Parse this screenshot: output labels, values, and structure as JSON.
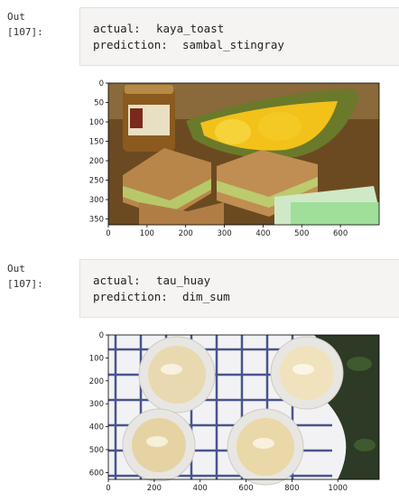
{
  "outputs": [
    {
      "prompt_out": "Out",
      "prompt_num": "[107]:",
      "actual_label": "actual:",
      "actual_value": "kaya_toast",
      "prediction_label": "prediction:",
      "prediction_value": "sambal_stingray",
      "image_plot": {
        "x_ticks": [
          "0",
          "100",
          "200",
          "300",
          "400",
          "500",
          "600"
        ],
        "y_ticks": [
          "0",
          "50",
          "100",
          "150",
          "200",
          "250",
          "300",
          "350"
        ],
        "x_range": [
          0,
          700
        ],
        "y_range": [
          0,
          365
        ],
        "photo": "kaya toast sandwiches with jar and durian"
      }
    },
    {
      "prompt_out": "Out",
      "prompt_num": "[107]:",
      "actual_label": "actual:",
      "actual_value": "tau_huay",
      "prediction_label": "prediction:",
      "prediction_value": "dim_sum",
      "image_plot": {
        "x_ticks": [
          "0",
          "200",
          "400",
          "600",
          "800",
          "1000"
        ],
        "y_ticks": [
          "0",
          "100",
          "200",
          "300",
          "400",
          "500",
          "600"
        ],
        "x_range": [
          0,
          1180
        ],
        "y_range": [
          0,
          630
        ],
        "photo": "four cups of tau huay on checkered cloth"
      }
    }
  ]
}
